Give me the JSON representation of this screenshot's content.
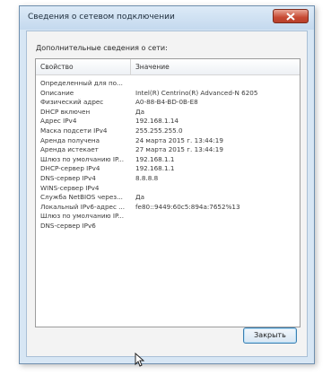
{
  "window": {
    "title": "Сведения о сетевом подключении",
    "close_icon": "close-x-icon"
  },
  "section_label": "Дополнительные сведения о сети:",
  "grid": {
    "header_property": "Свойство",
    "header_value": "Значение",
    "rows": [
      {
        "property": "Определенный для по...",
        "value": ""
      },
      {
        "property": "Описание",
        "value": "Intel(R) Centrino(R) Advanced-N 6205"
      },
      {
        "property": "Физический адрес",
        "value": "A0-88-B4-BD-0B-E8"
      },
      {
        "property": "DHCP включен",
        "value": "Да"
      },
      {
        "property": "Адрес IPv4",
        "value": "192.168.1.14"
      },
      {
        "property": "Маска подсети IPv4",
        "value": "255.255.255.0"
      },
      {
        "property": "Аренда получена",
        "value": "24 марта 2015 г. 13:44:19"
      },
      {
        "property": "Аренда истекает",
        "value": "27 марта 2015 г. 13:44:19"
      },
      {
        "property": "Шлюз по умолчанию IP...",
        "value": "192.168.1.1"
      },
      {
        "property": "DHCP-сервер IPv4",
        "value": "192.168.1.1"
      },
      {
        "property": "DNS-сервер IPv4",
        "value": "8.8.8.8"
      },
      {
        "property": "WINS-сервер IPv4",
        "value": ""
      },
      {
        "property": "Служба NetBIOS через...",
        "value": "Да"
      },
      {
        "property": "Локальный IPv6-адрес ...",
        "value": "fe80::9449:60c5:894a:7652%13"
      },
      {
        "property": "Шлюз по умолчанию IP...",
        "value": ""
      },
      {
        "property": "DNS-сервер IPv6",
        "value": ""
      }
    ]
  },
  "close_button_label": "Закрыть",
  "cursor_icon": "mouse-pointer-icon"
}
